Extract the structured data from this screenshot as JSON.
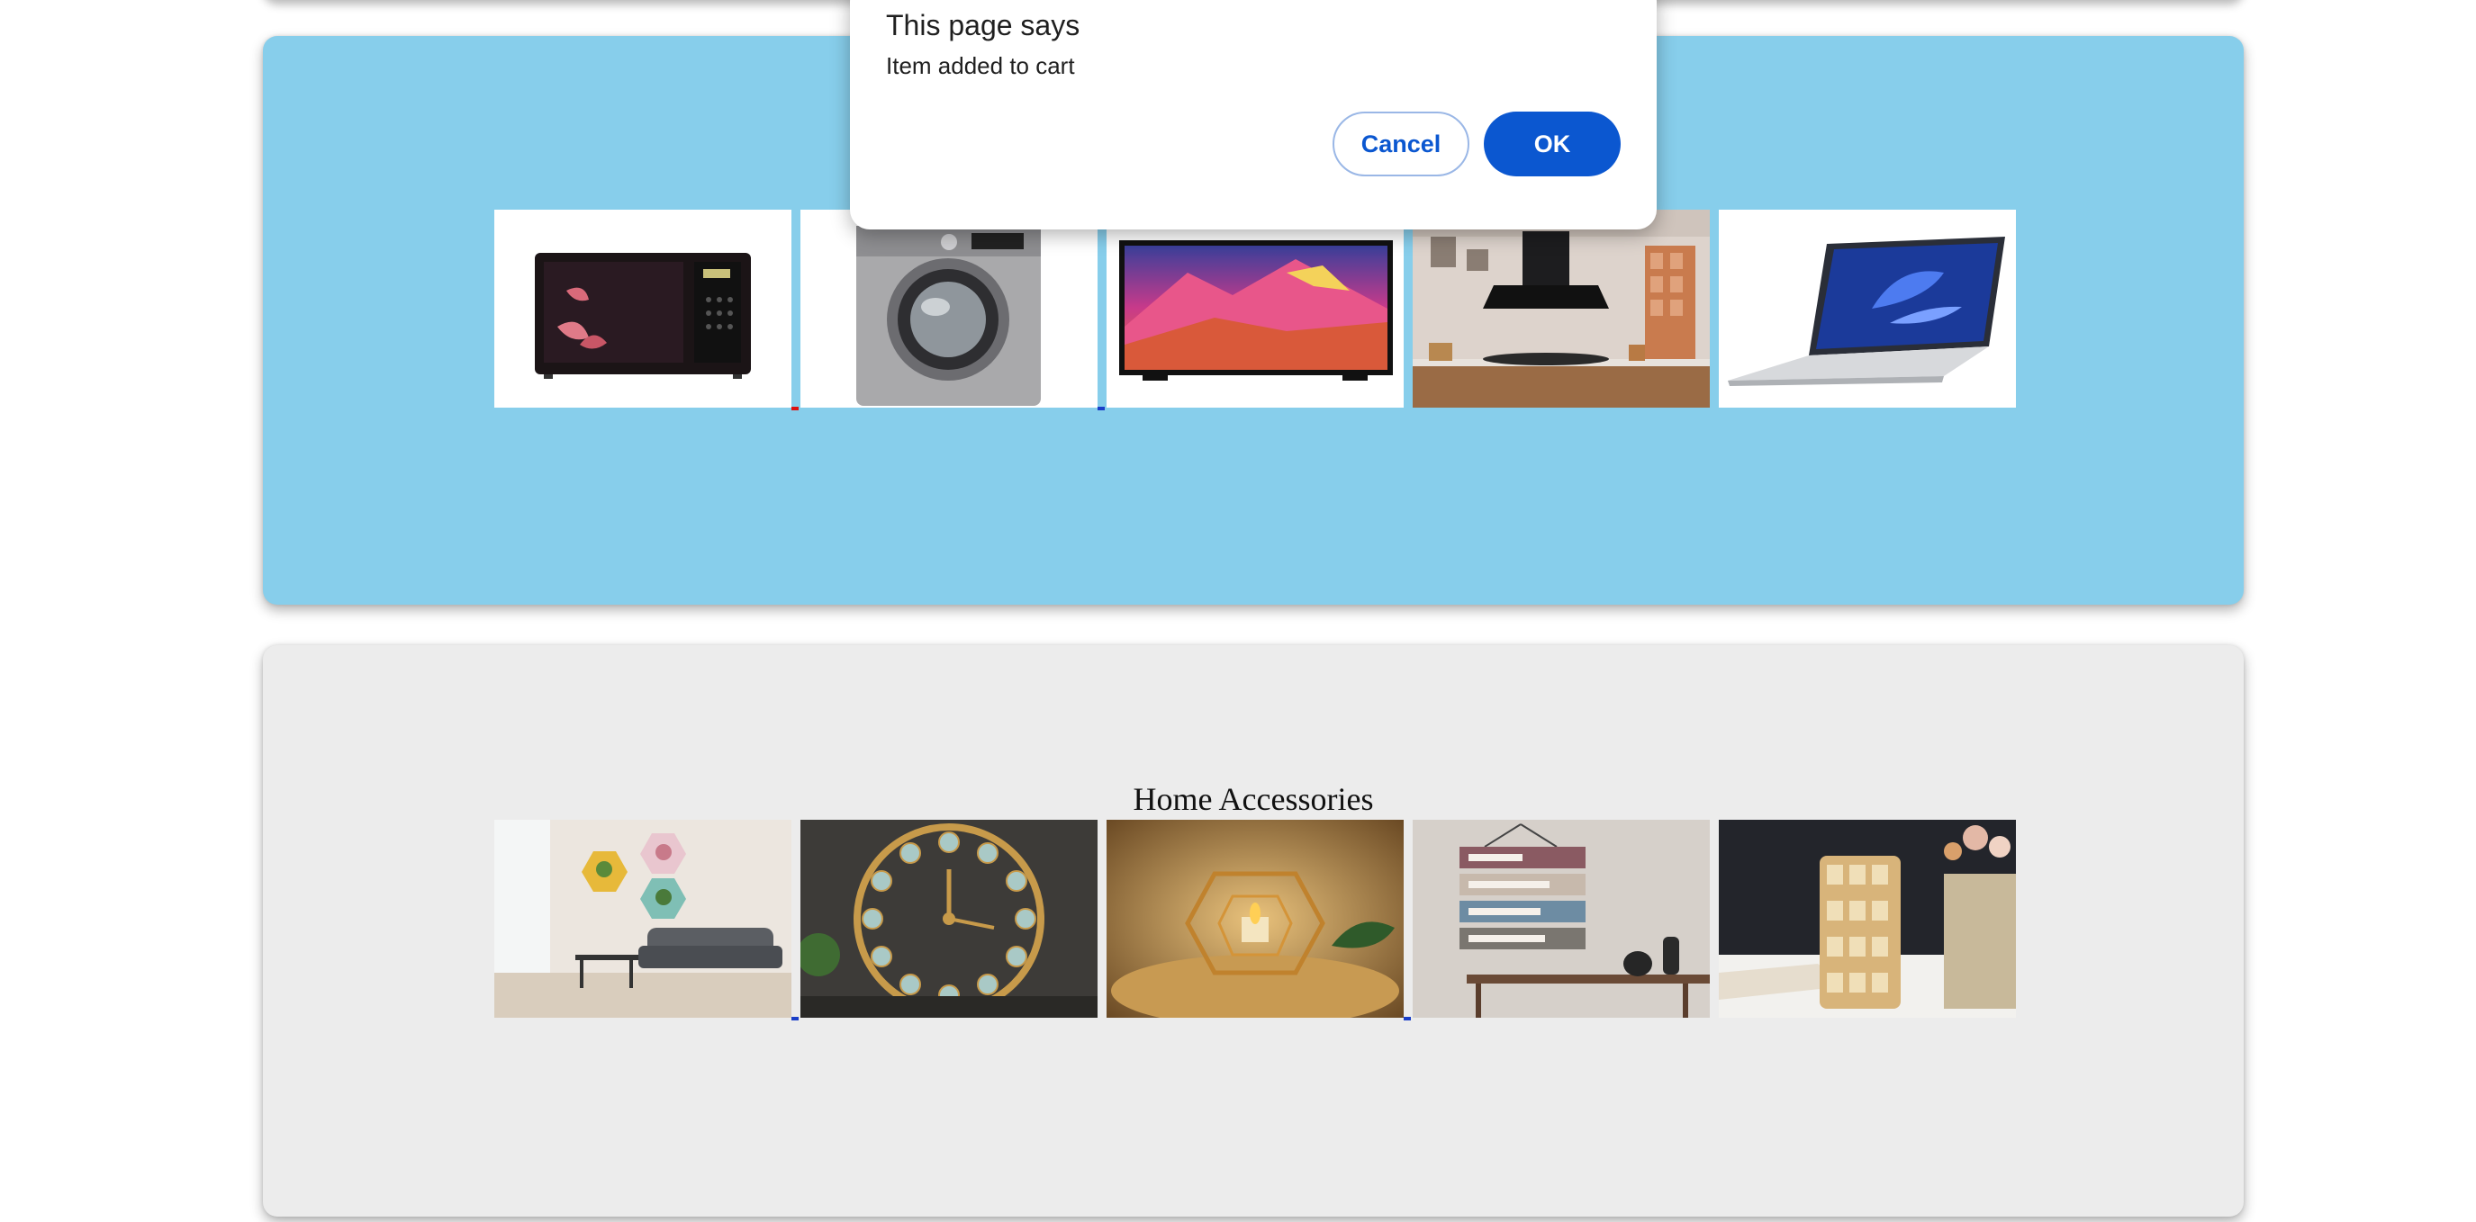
{
  "dialog": {
    "title": "This page says",
    "message": "Item added to cart",
    "cancel_label": "Cancel",
    "ok_label": "OK"
  },
  "sections": {
    "electronics": {
      "background": "#87ceeb",
      "products": [
        {
          "name": "microwave-oven-image"
        },
        {
          "name": "washing-machine-image"
        },
        {
          "name": "television-image"
        },
        {
          "name": "kitchen-chimney-image"
        },
        {
          "name": "laptop-image"
        }
      ]
    },
    "home": {
      "title": "Home Accessories",
      "background": "#ececec",
      "products": [
        {
          "name": "wall-planters-image"
        },
        {
          "name": "wall-clock-image"
        },
        {
          "name": "candle-holder-image"
        },
        {
          "name": "wall-sign-image"
        },
        {
          "name": "glass-vases-image"
        }
      ]
    }
  },
  "colors": {
    "dialog_accent": "#0b57d0",
    "link_underline_red": "#dd1111",
    "link_underline_blue": "#1a3ec8"
  }
}
